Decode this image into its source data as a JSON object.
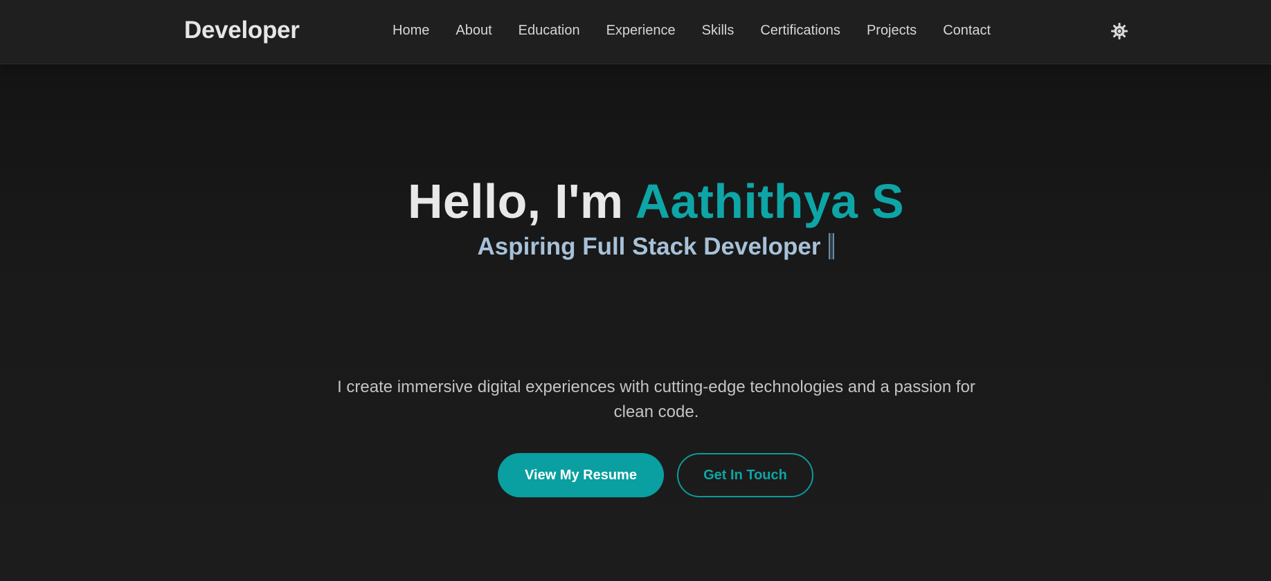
{
  "navbar": {
    "brand": "Developer",
    "links": [
      {
        "label": "Home"
      },
      {
        "label": "About"
      },
      {
        "label": "Education"
      },
      {
        "label": "Experience"
      },
      {
        "label": "Skills"
      },
      {
        "label": "Certifications"
      },
      {
        "label": "Projects"
      },
      {
        "label": "Contact"
      }
    ],
    "theme_toggle_icon": "sun-icon"
  },
  "hero": {
    "greeting": "Hello, I'm",
    "name": "Aathithya S",
    "subtitle": "Aspiring Full Stack Developer",
    "description": "I create immersive digital experiences with cutting-edge technologies and a passion for clean code.",
    "primary_button": "View My Resume",
    "secondary_button": "Get In Touch"
  },
  "colors": {
    "accent": "#0ea5a6",
    "background": "#1c1c1c",
    "navbar_bg": "#1f1f1f",
    "subtitle": "#a7c1d8",
    "text": "#e8e8e8"
  }
}
